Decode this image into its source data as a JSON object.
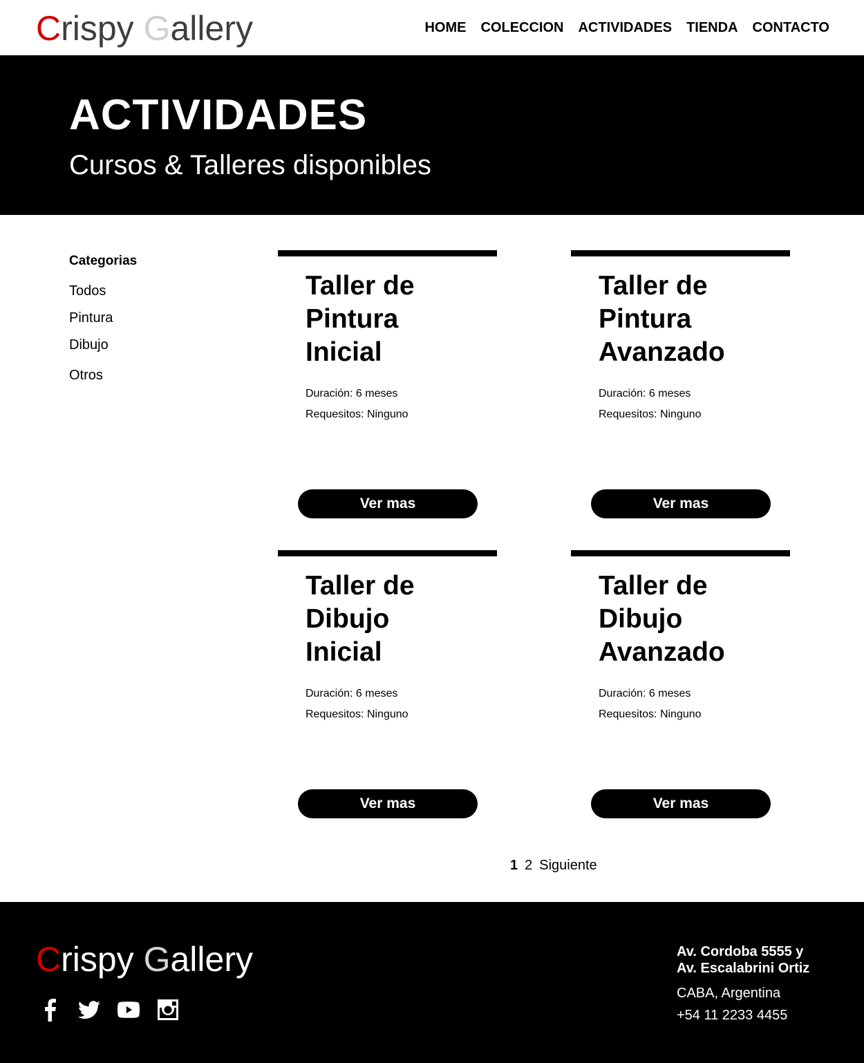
{
  "brand": {
    "c": "C",
    "rispy": "rispy ",
    "g": "G",
    "allery": "allery"
  },
  "nav": [
    "HOME",
    "COLECCION",
    "ACTIVIDADES",
    "TIENDA",
    "CONTACTO"
  ],
  "hero": {
    "title": "ACTIVIDADES",
    "subtitle": "Cursos & Talleres disponibles"
  },
  "sidebar": {
    "title": "Categorias",
    "items": [
      "Todos",
      "Pintura",
      "Dibujo",
      "Otros"
    ]
  },
  "cards": [
    {
      "title_l1": "Taller de",
      "title_l2": "Pintura",
      "title_l3": "Inicial",
      "duration": "Duración: 6 meses",
      "requirements": "Requesitos: Ninguno",
      "button": "Ver mas"
    },
    {
      "title_l1": "Taller de",
      "title_l2": "Pintura",
      "title_l3": "Avanzado",
      "duration": "Duración: 6 meses",
      "requirements": "Requesitos: Ninguno",
      "button": "Ver mas"
    },
    {
      "title_l1": "Taller de",
      "title_l2": "Dibujo",
      "title_l3": "Inicial",
      "duration": "Duración: 6 meses",
      "requirements": "Requesitos: Ninguno",
      "button": "Ver mas"
    },
    {
      "title_l1": "Taller de",
      "title_l2": "Dibujo",
      "title_l3": "Avanzado",
      "duration": "Duración: 6 meses",
      "requirements": "Requesitos: Ninguno",
      "button": "Ver mas"
    }
  ],
  "pagination": {
    "current": "1",
    "next_page": "2",
    "next_label": "Siguiente"
  },
  "footer": {
    "address_l1": "Av. Cordoba 5555 y",
    "address_l2": "Av. Escalabrini Ortiz",
    "city": "CABA, Argentina",
    "phone": "+54 11 2233 4455",
    "social_icons": [
      "facebook-icon",
      "twitter-icon",
      "youtube-icon",
      "instagram-icon"
    ]
  },
  "colors": {
    "brand_red": "#d10000",
    "brand_gray": "#cfcfcf",
    "text_dark": "#3e3e3e",
    "black": "#000000",
    "white": "#ffffff"
  }
}
